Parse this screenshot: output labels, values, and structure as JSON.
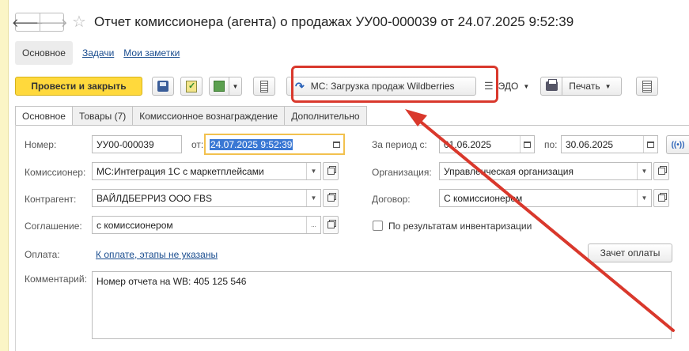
{
  "header": {
    "back": "🡐",
    "forward": "🡒",
    "title": "Отчет комиссионера (агента) о продажах УУ00-000039 от 24.07.2025 9:52:39"
  },
  "sections": {
    "main": "Основное",
    "tasks": "Задачи",
    "notes": "Мои заметки"
  },
  "toolbar": {
    "post_close": "Провести и закрыть",
    "wb_load": "МС: Загрузка продаж Wildberries",
    "edo": "ЭДО",
    "print": "Печать"
  },
  "tabs": [
    {
      "label": "Основное"
    },
    {
      "label": "Товары (7)"
    },
    {
      "label": "Комиссионное вознаграждение"
    },
    {
      "label": "Дополнительно"
    }
  ],
  "form": {
    "number_label": "Номер:",
    "number": "УУ00-000039",
    "date_label": "от:",
    "date": "24.07.2025  9:52:39",
    "period_label": "За период с:",
    "period_from": "01.06.2025",
    "period_to_label": "по:",
    "period_to": "30.06.2025",
    "commissioner_label": "Комиссионер:",
    "commissioner": "МС:Интеграция 1С с маркетплейсами",
    "org_label": "Организация:",
    "org": "Управленческая организация",
    "counterparty_label": "Контрагент:",
    "counterparty": "ВАЙЛДБЕРРИЗ ООО FBS",
    "contract_label": "Договор:",
    "contract": "С комиссионером",
    "agreement_label": "Соглашение:",
    "agreement": "с комиссионером",
    "inventory_label": "По результатам инвентаризации",
    "payment_label": "Оплата:",
    "payment_link": "К оплате, этапы не указаны",
    "payment_btn": "Зачет оплаты",
    "comment_label": "Комментарий:",
    "comment": "Номер отчета на WB: 405 125 546"
  },
  "colors": {
    "primary_button": "#ffd93c",
    "annotation": "#d9382c",
    "link": "#1a4d8f"
  }
}
